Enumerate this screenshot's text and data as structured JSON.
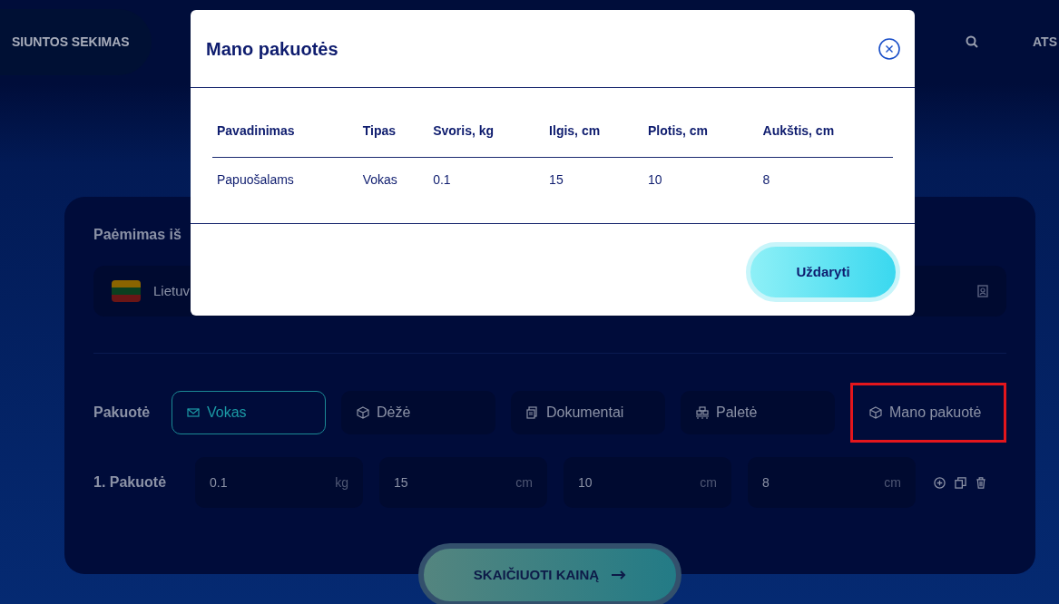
{
  "header": {
    "tracking": "SIUNTOS SEKIMAS",
    "cut_link": "ATS"
  },
  "pickup": {
    "label": "Paėmimas iš",
    "country": "Lietuv"
  },
  "package_types": {
    "label": "Pakuotė",
    "options": [
      {
        "label": "Vokas",
        "kind": "envelope",
        "selected": true,
        "highlighted": false
      },
      {
        "label": "Dėžė",
        "kind": "box",
        "selected": false,
        "highlighted": false
      },
      {
        "label": "Dokumentai",
        "kind": "documents",
        "selected": false,
        "highlighted": false
      },
      {
        "label": "Paletė",
        "kind": "pallet",
        "selected": false,
        "highlighted": false
      },
      {
        "label": "Mano pakuotė",
        "kind": "box",
        "selected": false,
        "highlighted": true
      }
    ]
  },
  "package_row": {
    "label": "1. Pakuotė",
    "fields": [
      {
        "value": "0.1",
        "unit": "kg"
      },
      {
        "value": "15",
        "unit": "cm"
      },
      {
        "value": "10",
        "unit": "cm"
      },
      {
        "value": "8",
        "unit": "cm"
      }
    ]
  },
  "calculate_button": "SKAIČIUOTI KAINĄ",
  "modal": {
    "title": "Mano pakuotės",
    "columns": [
      "Pavadinimas",
      "Tipas",
      "Svoris, kg",
      "Ilgis, cm",
      "Plotis, cm",
      "Aukštis, cm"
    ],
    "rows": [
      [
        "Papuošalams",
        "Vokas",
        "0.1",
        "15",
        "10",
        "8"
      ]
    ],
    "close_button": "Uždaryti"
  }
}
